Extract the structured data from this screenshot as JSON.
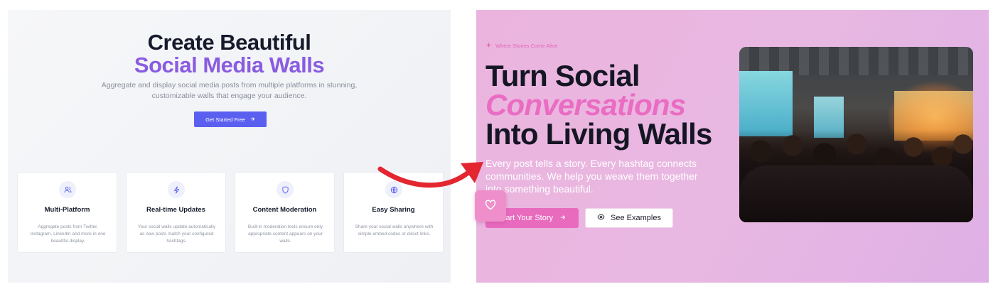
{
  "left": {
    "title_line1": "Create Beautiful",
    "title_line2": "Social Media Walls",
    "subtitle": "Aggregate and display social media posts from multiple platforms in stunning, customizable walls that engage your audience.",
    "cta_label": "Get Started Free",
    "cta_icon": "arrow-right-icon",
    "accent_color": "#8a5ce0",
    "button_color": "#5b5ff0",
    "features": [
      {
        "icon": "users-icon",
        "title": "Multi-Platform",
        "desc": "Aggregate posts from Twitter, Instagram, LinkedIn and more in one beautiful display."
      },
      {
        "icon": "lightning-icon",
        "title": "Real-time Updates",
        "desc": "Your social walls update automatically as new posts match your configured hashtags."
      },
      {
        "icon": "shield-icon",
        "title": "Content Moderation",
        "desc": "Built-in moderation tools ensure only appropriate content appears on your walls."
      },
      {
        "icon": "globe-icon",
        "title": "Easy Sharing",
        "desc": "Share your social walls anywhere with simple embed codes or direct links."
      }
    ]
  },
  "right": {
    "tagline": "Where Stories Come Alive",
    "tagline_icon": "sparkle-icon",
    "heading_line1": "Turn Social",
    "heading_line2": "Conversations",
    "heading_line3": "Into Living Walls",
    "subtitle": "Every post tells a story. Every hashtag connects communities. We help you weave them together into something beautiful.",
    "primary_label": "Start Your Story",
    "primary_icon": "arrow-right-icon",
    "secondary_label": "See Examples",
    "secondary_icon": "eye-icon",
    "heart_icon": "heart-icon",
    "accent_color": "#ea6cc3"
  },
  "transition_arrow": "curved-arrow-icon"
}
